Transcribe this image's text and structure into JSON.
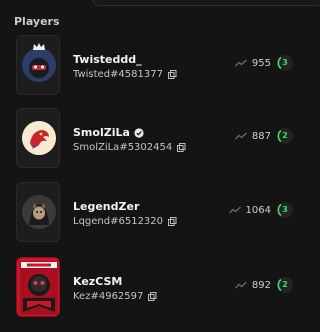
{
  "section_title": "Players",
  "players": [
    {
      "name": "Twisteddd_",
      "tag": "Twisted#4581377",
      "score": "955",
      "level": "3",
      "verified": false,
      "avatar_icon": "crowned-masked-avatar"
    },
    {
      "name": "SmolZiLa",
      "tag": "SmolZiLa#5302454",
      "score": "887",
      "level": "2",
      "verified": true,
      "avatar_icon": "red-dragon-avatar"
    },
    {
      "name": "LegendZer",
      "tag": "Lqgend#6512320",
      "score": "1064",
      "level": "3",
      "verified": false,
      "avatar_icon": "hooded-cat-avatar"
    },
    {
      "name": "KezCSM",
      "tag": "Kez#4962597",
      "score": "892",
      "level": "2",
      "verified": false,
      "avatar_icon": "red-banner-skull-avatar"
    }
  ],
  "colors": {
    "background": "#141414",
    "accent_green": "#3ddc6a",
    "banner_red": "#d4152a"
  }
}
